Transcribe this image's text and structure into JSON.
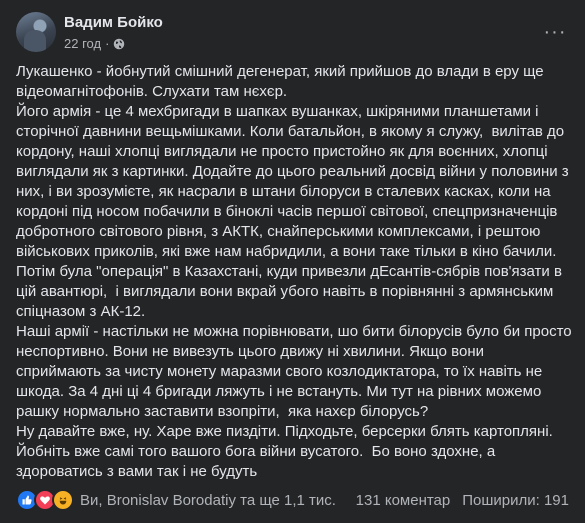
{
  "author": {
    "name": "Вадим Бойко",
    "time": "22 год",
    "separator": "·"
  },
  "post": {
    "text": "Лукашенко - йобнутий смішний дегенерат, який прийшов до влади в еру ще відеомагнітофонів. Слухати там нєхєр.\nЙого армія - це 4 мехбригади в шапках вушанках, шкіряними планшетами і сторічної давнини вещьмішками. Коли батальйон, в якому я служу,  вилітав до кордону, наші хлопці виглядали не просто пристойно як для воєнних, хлопці виглядали як з картинки. Додайте до цього реальний досвід війни у половини з них, і ви зрозумієте, як насрали в штани білоруси в сталевих касках, коли на кордоні під носом побачили в біноклі часів першої світової, спецпризначенців добротного світового рівня, з АКТК, снайперськими комплексами, і рештою військових приколів, які вже нам набридили, а вони таке тільки в кіно бачили.\nПотім була \"операція\" в Казахстані, куди привезли дЕсантів-сябрів пов'язати в цій авантюрі,  і виглядали вони вкрай убого навіть в порівнянні з армянським спіцназом з АК-12.\nНаші армії - настільки не можна порівнювати, шо бити білорусів було би просто неспортивно. Вони не вивезуть цього движу ні хвилини. Якщо вони сприймають за чисту монету маразми свого козлодиктатора, то їх навіть не шкода. За 4 дні ці 4 бригади ляжуть і не встануть. Ми тут на рівних можемо рашку нормально заставити взопріти,  яка нахєр білорусь?\nНу давайте вже, ну. Харе вже пиздіти. Підходьте, берсерки блять картопляні. Йобніть вже самі того вашого бога війни вусатого.  Бо воно здохне, а здороватись з вами так і не будуть"
  },
  "footer": {
    "reactions": [
      "like-icon",
      "love-icon",
      "haha-icon"
    ],
    "reactors": "Ви, Bronislav Borodatiy та ще 1,1 тис.",
    "comments": "131 коментар",
    "shares": "Поширили: 191"
  },
  "colors": {
    "background": "#242526",
    "text": "#e4e6eb",
    "secondary": "#b0b3b8",
    "like": "#2078f4",
    "love": "#f33e58",
    "haha": "#f7b125"
  }
}
